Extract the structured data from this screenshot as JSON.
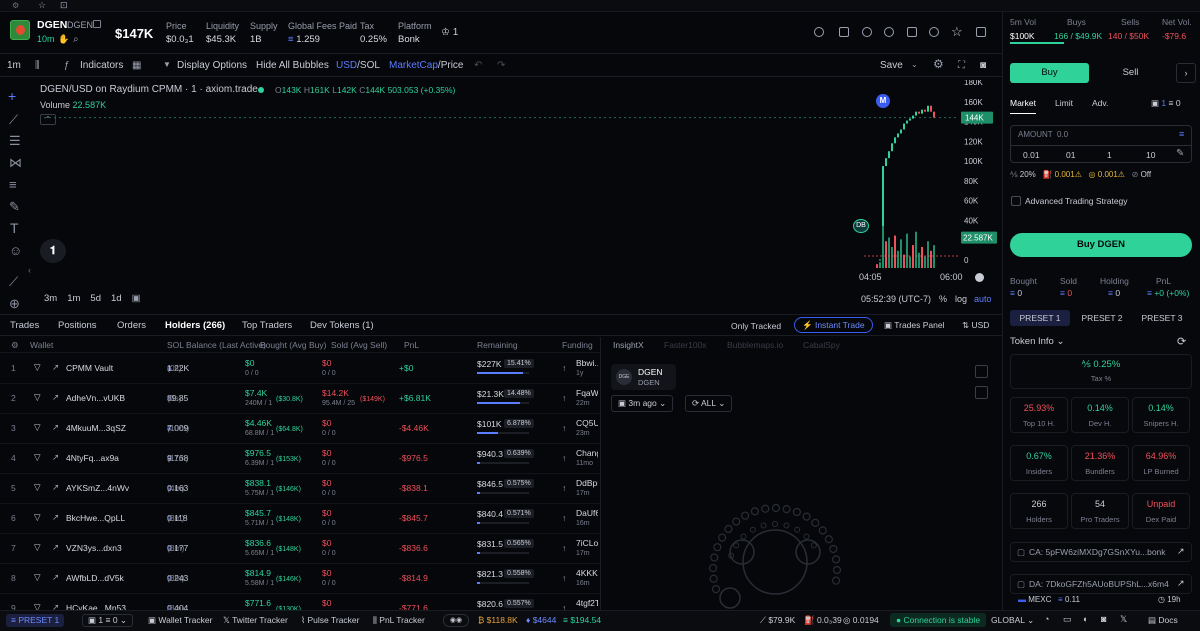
{
  "token": {
    "ticker": "DGEN",
    "name": "DGEN",
    "age": "10m",
    "market_cap": "$147K"
  },
  "stats": [
    {
      "label": "Price",
      "value": "$0.0₃1"
    },
    {
      "label": "Liquidity",
      "value": "$45.3K"
    },
    {
      "label": "Supply",
      "value": "1B"
    },
    {
      "label": "Global Fees Paid",
      "value": "1.259"
    },
    {
      "label": "Tax",
      "value": "0.25%"
    },
    {
      "label": "Platform",
      "value": "Bonk"
    }
  ],
  "platform_count": "1",
  "toolbar": {
    "interval": "1m",
    "indicators": "Indicators",
    "display_options": "Display Options",
    "hide_bubbles": "Hide All Bubbles",
    "usd": "USD",
    "sol": "SOL",
    "mcap": "MarketCap",
    "price": "Price",
    "save": "Save"
  },
  "chart": {
    "pair": "DGEN/USD on Raydium CPMM · 1 · axiom.trade",
    "ohlc_o": "143K",
    "ohlc_h": "161K",
    "ohlc_l": "142K",
    "ohlc_c": "144K",
    "ohlc_chg": "503.053 (+0.35%)",
    "volume_label": "Volume",
    "volume_value": "22.587K",
    "price_tag": "144K",
    "vol_tag": "22.587K",
    "time_start": "04:05",
    "time_end": "06:00",
    "clock": "05:52:39 (UTC-7)",
    "ranges": [
      "3m",
      "1m",
      "5d",
      "1d"
    ],
    "log": "log",
    "auto": "auto",
    "marker_m": "M",
    "marker_db": "DB"
  },
  "chart_data": {
    "type": "line",
    "title": "",
    "ylabel": "",
    "ylim": [
      0,
      180
    ],
    "yticks": [
      "180K",
      "160K",
      "140K",
      "120K",
      "100K",
      "80K",
      "60K",
      "40K",
      "20K",
      "0"
    ],
    "x": [
      0,
      1,
      2,
      3,
      4,
      5,
      6,
      7,
      8,
      9,
      10,
      11,
      12,
      13,
      14,
      15,
      16,
      17,
      18,
      19
    ],
    "y": [
      0,
      0.5,
      95,
      103,
      110,
      118,
      124,
      128,
      132,
      138,
      141,
      143,
      146,
      150,
      148,
      152,
      150,
      156,
      150,
      144
    ],
    "volume": [
      2,
      3,
      22,
      14,
      16,
      11,
      17,
      9,
      15,
      7,
      18,
      6,
      12,
      19,
      8,
      11,
      6,
      14,
      9,
      12
    ]
  },
  "tabs": [
    "Trades",
    "Positions",
    "Orders",
    "Holders (266)",
    "Top Traders",
    "Dev Tokens (1)"
  ],
  "tab_controls": {
    "only_tracked": "Only Tracked",
    "instant_trade": "Instant Trade",
    "trades_panel": "Trades Panel",
    "usd": "USD"
  },
  "columns": [
    "Wallet",
    "SOL Balance (Last Active)",
    "Bought (Avg Buy)",
    "Sold (Avg Sell)",
    "PnL",
    "Remaining",
    "Funding"
  ],
  "holders": [
    {
      "rank": "1",
      "wallet": "CPMM Vault",
      "sol": "1.22K",
      "sol_age": "(0s)",
      "bought": "$0",
      "bought_sub": "0 / 0",
      "bought_avg": "",
      "sold": "$0",
      "sold_sub": "0 / 0",
      "sold_avg": "",
      "pnl": "+$0",
      "remaining": "$227K",
      "pct": "15.41%",
      "fund": "Bbwi...",
      "fund_sub": "1y"
    },
    {
      "rank": "2",
      "wallet": "AdheVn...vUKB",
      "sol": "89.85",
      "sol_age": "(0s)",
      "bought": "$7.4K",
      "bought_sub": "240M / 1",
      "bought_avg": "($30.8K)",
      "sold": "$14.2K",
      "sold_sub": "95.4M / 25",
      "sold_avg": "($149K)",
      "pnl": "+$6.81K",
      "remaining": "$21.3K",
      "pct": "14.48%",
      "fund": "FqaWE...",
      "fund_sub": "22m"
    },
    {
      "rank": "3",
      "wallet": "4MkuuM...3qSZ",
      "sol": "7.009",
      "sol_age": "(10m)",
      "bought": "$4.46K",
      "bought_sub": "68.8M / 1",
      "bought_avg": "($64.8K)",
      "sold": "$0",
      "sold_sub": "0 / 0",
      "sold_avg": "",
      "pnl": "-$4.46K",
      "remaining": "$101K",
      "pct": "6.878%",
      "fund": "CQ5UF...",
      "fund_sub": "23m"
    },
    {
      "rank": "4",
      "wallet": "4NtyFq...ax9a",
      "sol": "9.768",
      "sol_age": "(11m)",
      "bought": "$976.5",
      "bought_sub": "6.39M / 1",
      "bought_avg": "($153K)",
      "sold": "$0",
      "sold_sub": "0 / 0",
      "sold_avg": "",
      "pnl": "-$976.5",
      "remaining": "$940.3",
      "pct": "0.639%",
      "fund": "Change...",
      "fund_sub": "11mo"
    },
    {
      "rank": "5",
      "wallet": "AYKSmZ...4nWv",
      "sol": "0.163",
      "sol_age": "(4m)",
      "bought": "$838.1",
      "bought_sub": "5.75M / 1",
      "bought_avg": "($146K)",
      "sold": "$0",
      "sold_sub": "0 / 0",
      "sold_avg": "",
      "pnl": "-$838.1",
      "remaining": "$846.5",
      "pct": "0.575%",
      "fund": "DdBpL...",
      "fund_sub": "17m"
    },
    {
      "rank": "6",
      "wallet": "BkcHwe...QpLL",
      "sol": "0.118",
      "sol_age": "(3m)",
      "bought": "$845.7",
      "bought_sub": "5.71M / 1",
      "bought_avg": "($148K)",
      "sold": "$0",
      "sold_sub": "0 / 0",
      "sold_avg": "",
      "pnl": "-$845.7",
      "remaining": "$840.4",
      "pct": "0.571%",
      "fund": "DaUf6...",
      "fund_sub": "16m"
    },
    {
      "rank": "7",
      "wallet": "VZN3ys...dxn3",
      "sol": "0.177",
      "sol_age": "(3m)",
      "bought": "$836.6",
      "bought_sub": "5.65M / 1",
      "bought_avg": "($148K)",
      "sold": "$0",
      "sold_sub": "0 / 0",
      "sold_avg": "",
      "pnl": "-$836.6",
      "remaining": "$831.5",
      "pct": "0.565%",
      "fund": "7iCLoS...",
      "fund_sub": "17m"
    },
    {
      "rank": "8",
      "wallet": "AWfbLD...dV5k",
      "sol": "0.243",
      "sol_age": "(3m)",
      "bought": "$814.9",
      "bought_sub": "5.58M / 1",
      "bought_avg": "($146K)",
      "sold": "$0",
      "sold_sub": "0 / 0",
      "sold_avg": "",
      "pnl": "-$814.9",
      "remaining": "$821.3",
      "pct": "0.558%",
      "fund": "4KKKk...",
      "fund_sub": "16m"
    },
    {
      "rank": "9",
      "wallet": "HCyKae...Mn53",
      "sol": "0.404",
      "sol_age": "(8m)",
      "bought": "$771.6",
      "bought_sub": "",
      "bought_avg": "($130K)",
      "sold": "$0",
      "sold_sub": "",
      "sold_avg": "",
      "pnl": "-$771.6",
      "remaining": "$820.6",
      "pct": "0.557%",
      "fund": "4tgf2T...",
      "fund_sub": ""
    }
  ],
  "insight": {
    "tabs": [
      "InsightX",
      "Faster100x",
      "Bubblemaps.io",
      "CabalSpy"
    ],
    "ticker": "DGEN",
    "name": "DGEN",
    "time_filter": "3m ago",
    "all_filter": "ALL"
  },
  "right": {
    "stats_hdr": [
      "5m Vol",
      "Buys",
      "Sells",
      "Net Vol."
    ],
    "stats_val": [
      "$100K",
      "166 / $49.9K",
      "140 / $50K",
      "-$79.6"
    ],
    "buy": "Buy",
    "sell": "Sell",
    "order_tabs": [
      "Market",
      "Limit",
      "Adv."
    ],
    "wallets": "1",
    "balance": "0",
    "amount_label": "AMOUNT",
    "amount_value": "0.0",
    "quick": [
      "0.01",
      "01",
      "1",
      "10"
    ],
    "slip": "20%",
    "prio": "0.001",
    "bribe": "0.001",
    "mev": "Off",
    "adv_strategy": "Advanced Trading Strategy",
    "buy_token": "Buy DGEN",
    "pos_hdr": [
      "Bought",
      "Sold",
      "Holding",
      "PnL"
    ],
    "pos_val": [
      "0",
      "0",
      "0",
      "+0 (+0%)"
    ],
    "presets": [
      "PRESET 1",
      "PRESET 2",
      "PRESET 3"
    ],
    "token_info": "Token Info",
    "tax_val": "0.25%",
    "tax_lbl": "Tax %",
    "metrics": [
      {
        "value": "25.93%",
        "label": "Top 10 H.",
        "color": "#f0505c"
      },
      {
        "value": "0.14%",
        "label": "Dev H.",
        "color": "#2fd39a"
      },
      {
        "value": "0.14%",
        "label": "Snipers H.",
        "color": "#2fd39a"
      },
      {
        "value": "0.67%",
        "label": "Insiders",
        "color": "#2fd39a"
      },
      {
        "value": "21.36%",
        "label": "Bundlers",
        "color": "#f0505c"
      },
      {
        "value": "64.96%",
        "label": "LP Burned",
        "color": "#f0505c"
      },
      {
        "value": "266",
        "label": "Holders",
        "color": "#c9ccd6"
      },
      {
        "value": "54",
        "label": "Pro Traders",
        "color": "#c9ccd6"
      },
      {
        "value": "Unpaid",
        "label": "Dex Paid",
        "color": "#f0505c"
      }
    ],
    "ca": "CA: 5pFW6ziMXDg7GSnXYu...bonk",
    "da": "DA: 7DkoGFZh5AUoBUPShL...x6m4",
    "mexc": "MEXC",
    "mexc_val": "0.11",
    "mexc_age": "19h"
  },
  "footer": {
    "preset": "PRESET 1",
    "wallets": "1",
    "wallet_bal": "0",
    "items": [
      "Wallet Tracker",
      "Twitter Tracker",
      "Pulse Tracker",
      "PnL Tracker"
    ],
    "btc": "$118.8K",
    "eth": "$4644",
    "sol": "$194.54",
    "mcap_total": "$79.9K",
    "gas": "0.0₃39",
    "fee": "0.0194",
    "conn": "Connection is stable",
    "region": "GLOBAL",
    "docs": "Docs"
  }
}
